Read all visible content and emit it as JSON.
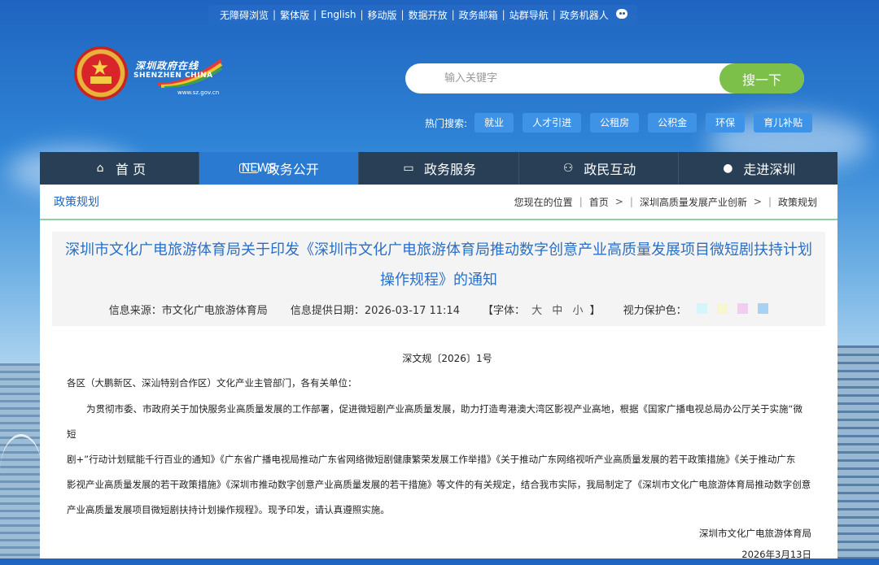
{
  "top_links": [
    "无障碍浏览",
    "繁体版",
    "English",
    "移动版",
    "数据开放",
    "政务邮箱",
    "站群导航",
    "政务机器人"
  ],
  "brand": {
    "cn": "深圳政府在线",
    "en": "SHENZHEN CHINA",
    "url": "www.sz.gov.cn"
  },
  "search": {
    "placeholder": "输入关键字",
    "button": "搜一下"
  },
  "hot_search": {
    "label": "热门搜索:",
    "tags": [
      "就业",
      "人才引进",
      "公租房",
      "公积金",
      "环保",
      "育儿补贴"
    ]
  },
  "nav": [
    {
      "label": "首 页",
      "icon": "home-icon"
    },
    {
      "label": "政务公开",
      "icon": "news-icon",
      "active": true
    },
    {
      "label": "政务服务",
      "icon": "monitor-icon"
    },
    {
      "label": "政民互动",
      "icon": "people-icon"
    },
    {
      "label": "走进深圳",
      "icon": "chat-icon"
    }
  ],
  "section_title": "政策规划",
  "breadcrumb": {
    "label": "您现在的位置",
    "items": [
      "首页",
      "深圳高质量发展产业创新",
      "政策规划"
    ]
  },
  "article": {
    "title_line1": "深圳市文化广电旅游体育局关于印发《深圳市文化广电旅游体育局推动数字创意产业高质量发展项目微短剧扶持计划",
    "title_line2": "操作规程》的通知",
    "source": "信息来源：市文化广电旅游体育局",
    "date": "信息提供日期：2026-03-17 11:14",
    "font_label": "【字体：",
    "font_sizes": [
      "大",
      "中",
      "小"
    ],
    "font_close": "】",
    "eye_label": "视力保护色：",
    "eye_colors": [
      "#d6f5fb",
      "#f8f6cf",
      "#f3cdf0",
      "#a8d2f4"
    ],
    "doc_number": "深文规〔2026〕1号",
    "addressee": "各区（大鹏新区、深汕特别合作区）文化产业主管部门，各有关单位：",
    "body_line1": "为贯彻市委、市政府关于加快服务业高质量发展的工作部署，促进微短剧产业高质量发展，助力打造粤港澳大湾区影视产业高地，根据《国家广播电视总局办公厅关于实施“微短",
    "body_line2": "剧+”行动计划赋能千行百业的通知》《广东省广播电视局推动广东省网络微短剧健康繁荣发展工作举措》《关于推动广东网络视听产业高质量发展的若干政策措施》《关于推动广东",
    "body_line3": "影视产业高质量发展的若干政策措施》《深圳市推动数字创意产业高质量发展的若干措施》等文件的有关规定，结合我市实际，我局制定了《深圳市文化广电旅游体育局推动数字创意",
    "body_line4": "产业高质量发展项目微短剧扶持计划操作规程》。现予印发，请认真遵照实施。",
    "signature": "深圳市文化广电旅游体育局",
    "sign_date": "2026年3月13日"
  }
}
